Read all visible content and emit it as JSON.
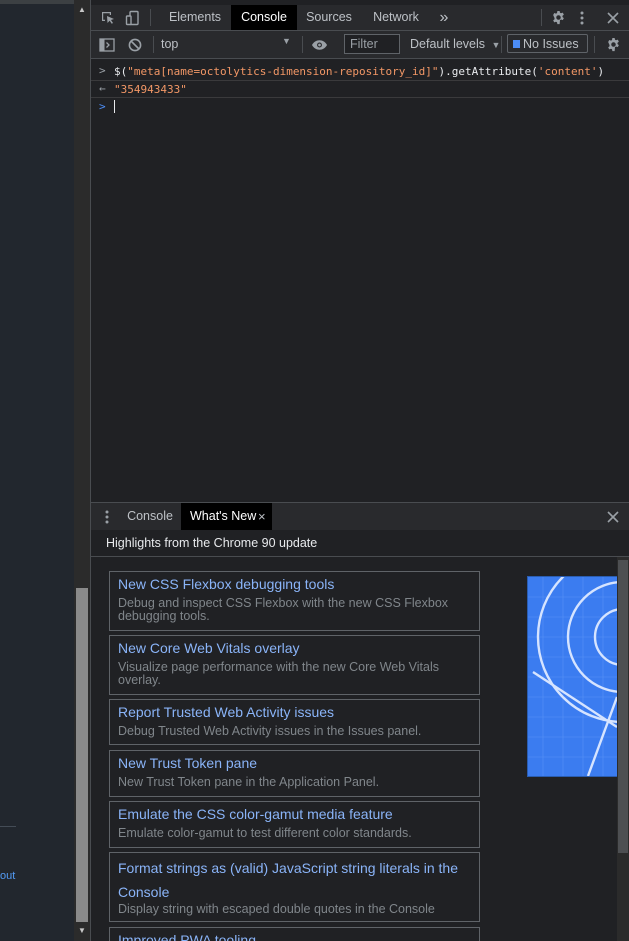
{
  "left_page": {
    "link_text": "out"
  },
  "devtools": {
    "main_tabs": [
      {
        "label": "Elements"
      },
      {
        "label": "Console"
      },
      {
        "label": "Sources"
      },
      {
        "label": "Network"
      }
    ],
    "more_tabs_glyph": "»",
    "console_toolbar": {
      "context": "top",
      "filter_placeholder": "Filter",
      "levels_label": "Default levels",
      "issues_label": "No Issues"
    },
    "console_lines": [
      {
        "prompt": ">",
        "parts": [
          {
            "text": "$(",
            "style": "def"
          },
          {
            "text": "\"meta[name=octolytics-dimension-repository_id]\"",
            "style": "str"
          },
          {
            "text": ").getAttribute(",
            "style": "def"
          },
          {
            "text": "'content'",
            "style": "str"
          },
          {
            "text": ")",
            "style": "def"
          }
        ]
      },
      {
        "prompt": "←",
        "parts": [
          {
            "text": "\"354943433\"",
            "style": "str"
          }
        ]
      }
    ],
    "drawer": {
      "tabs": [
        {
          "label": "Console"
        },
        {
          "label": "What's New"
        }
      ],
      "header": "Highlights from the Chrome 90 update",
      "items": [
        {
          "title": "New CSS Flexbox debugging tools",
          "desc": "Debug and inspect CSS Flexbox with the new CSS Flexbox debugging tools."
        },
        {
          "title": "New Core Web Vitals overlay",
          "desc": "Visualize page performance with the new Core Web Vitals overlay."
        },
        {
          "title": "Report Trusted Web Activity issues",
          "desc": "Debug Trusted Web Activity issues in the Issues panel."
        },
        {
          "title": "New Trust Token pane",
          "desc": "New Trust Token pane in the Application Panel."
        },
        {
          "title": "Emulate the CSS color-gamut media feature",
          "desc": "Emulate color-gamut to test different color standards."
        },
        {
          "title": "Format strings as (valid) JavaScript string literals in the Console",
          "desc": "Display string with escaped double quotes in the Console"
        },
        {
          "title": "Improved PWA tooling",
          "desc": ""
        }
      ]
    }
  },
  "colors": {
    "accent": "#8ab4f8",
    "string": "#f29766",
    "panel_bg": "#202124",
    "toolbar_bg": "#292a2d"
  }
}
